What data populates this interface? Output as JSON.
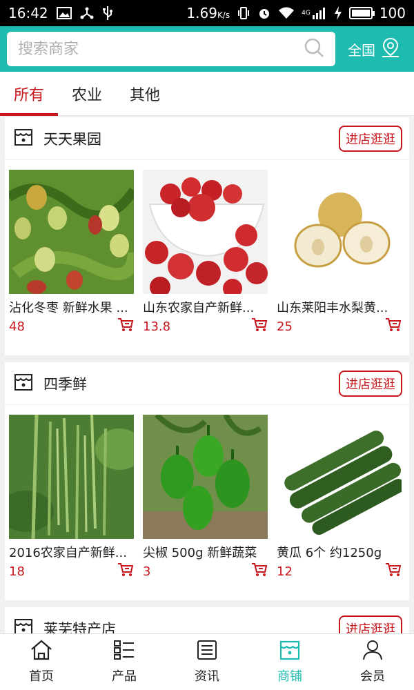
{
  "status_bar": {
    "time": "16:42",
    "speed": "1.69",
    "speed_unit": "K/s",
    "network": "4G",
    "battery": "100"
  },
  "search": {
    "placeholder": "搜索商家",
    "region_label": "全国"
  },
  "tabs": [
    {
      "label": "所有",
      "active": true
    },
    {
      "label": "农业",
      "active": false
    },
    {
      "label": "其他",
      "active": false
    }
  ],
  "shops": [
    {
      "name": "天天果园",
      "enter_label": "进店逛逛",
      "products": [
        {
          "title": "沾化冬枣 新鲜水果 ...",
          "price": "48"
        },
        {
          "title": "山东农家自产新鲜...",
          "price": "13.8"
        },
        {
          "title": "山东莱阳丰水梨黄...",
          "price": "25"
        }
      ]
    },
    {
      "name": "四季鲜",
      "enter_label": "进店逛逛",
      "products": [
        {
          "title": "2016农家自产新鲜...",
          "price": "18"
        },
        {
          "title": "尖椒 500g 新鲜蔬菜",
          "price": "3"
        },
        {
          "title": "黄瓜 6个 约1250g",
          "price": "12"
        }
      ]
    },
    {
      "name": "莱芜特产店",
      "enter_label": "进店逛逛"
    }
  ],
  "bottom_nav": [
    {
      "label": "首页",
      "icon": "home-icon"
    },
    {
      "label": "产品",
      "icon": "grid-list-icon"
    },
    {
      "label": "资讯",
      "icon": "news-icon"
    },
    {
      "label": "商铺",
      "icon": "store-icon",
      "active": true
    },
    {
      "label": "会员",
      "icon": "user-icon"
    }
  ],
  "colors": {
    "brand": "#1ebcb0",
    "accent": "#c8161d"
  }
}
